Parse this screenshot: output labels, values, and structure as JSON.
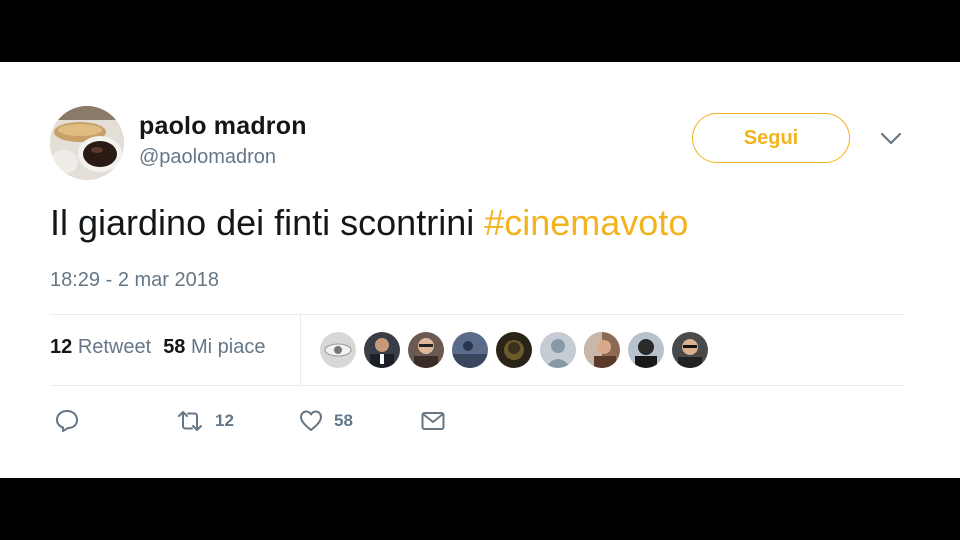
{
  "tweet": {
    "author": {
      "display_name": "paolo madron",
      "handle": "@paolomadron",
      "avatar": "avatar-photo"
    },
    "follow_label": "Segui",
    "text_plain": "Il giardino dei finti scontrini ",
    "hashtag": "#cinemavoto",
    "timestamp": "18:29 - 2 mar 2018",
    "stats": {
      "retweets_count": "12",
      "retweets_label": "Retweet",
      "likes_count": "58",
      "likes_label": "Mi piace"
    },
    "likers_count_shown": 9,
    "actions": {
      "reply_icon": "reply-icon",
      "retweet_icon": "retweet-icon",
      "retweet_count": "12",
      "like_icon": "heart-icon",
      "like_count": "58",
      "dm_icon": "envelope-icon"
    }
  },
  "colors": {
    "accent": "#f2b31d",
    "text": "#14171a",
    "muted": "#657786",
    "divider": "#e6ecf0",
    "frame": "#000000"
  }
}
